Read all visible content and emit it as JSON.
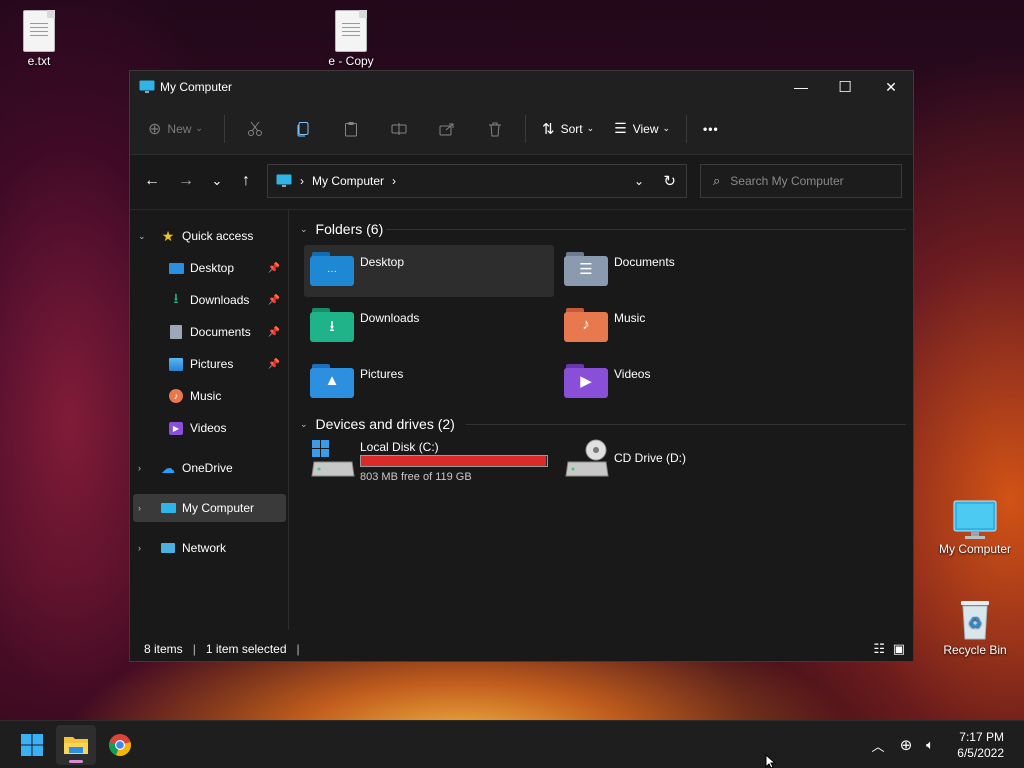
{
  "desktop": {
    "icons": [
      {
        "label": "e.txt"
      },
      {
        "label": "e - Copy"
      },
      {
        "label": "My Computer"
      },
      {
        "label": "Recycle Bin"
      }
    ]
  },
  "window": {
    "title": "My Computer",
    "controls": {
      "minimize": "—",
      "maximize": "☐",
      "close": "✕"
    }
  },
  "toolbar": {
    "new_label": "New",
    "sort_label": "Sort",
    "view_label": "View",
    "more_label": "•••"
  },
  "nav": {
    "breadcrumb": [
      "My Computer"
    ],
    "search_placeholder": "Search My Computer"
  },
  "sidebar": {
    "quick_access": "Quick access",
    "quick_items": [
      {
        "label": "Desktop",
        "icon": "desktop-icon",
        "pinned": true
      },
      {
        "label": "Downloads",
        "icon": "downloads-icon",
        "pinned": true
      },
      {
        "label": "Documents",
        "icon": "documents-icon",
        "pinned": true
      },
      {
        "label": "Pictures",
        "icon": "pictures-icon",
        "pinned": true
      },
      {
        "label": "Music",
        "icon": "music-icon",
        "pinned": false
      },
      {
        "label": "Videos",
        "icon": "videos-icon",
        "pinned": false
      }
    ],
    "onedrive": "OneDrive",
    "mycomputer": "My Computer",
    "network": "Network"
  },
  "content": {
    "folders_heading": "Folders (6)",
    "folders": [
      {
        "label": "Desktop",
        "color": "#1e88d4",
        "selected": true
      },
      {
        "label": "Documents",
        "color": "#8a9bb0",
        "selected": false
      },
      {
        "label": "Downloads",
        "color": "#1fb38a",
        "selected": false
      },
      {
        "label": "Music",
        "color": "#e8784e",
        "selected": false
      },
      {
        "label": "Pictures",
        "color": "#2d8fe0",
        "selected": false
      },
      {
        "label": "Videos",
        "color": "#8a4fd8",
        "selected": false
      }
    ],
    "drives_heading": "Devices and drives (2)",
    "drives": [
      {
        "label": "Local Disk (C:)",
        "free_text": "803 MB free of 119 GB",
        "used_fraction": 0.993
      },
      {
        "label": "CD Drive (D:)"
      }
    ]
  },
  "status": {
    "items": "8 items",
    "selected": "1 item selected"
  },
  "taskbar": {
    "time": "7:17 PM",
    "date": "6/5/2022"
  },
  "colors": {
    "drive_bar": "#da2a2a",
    "accent": "#0078d4"
  }
}
